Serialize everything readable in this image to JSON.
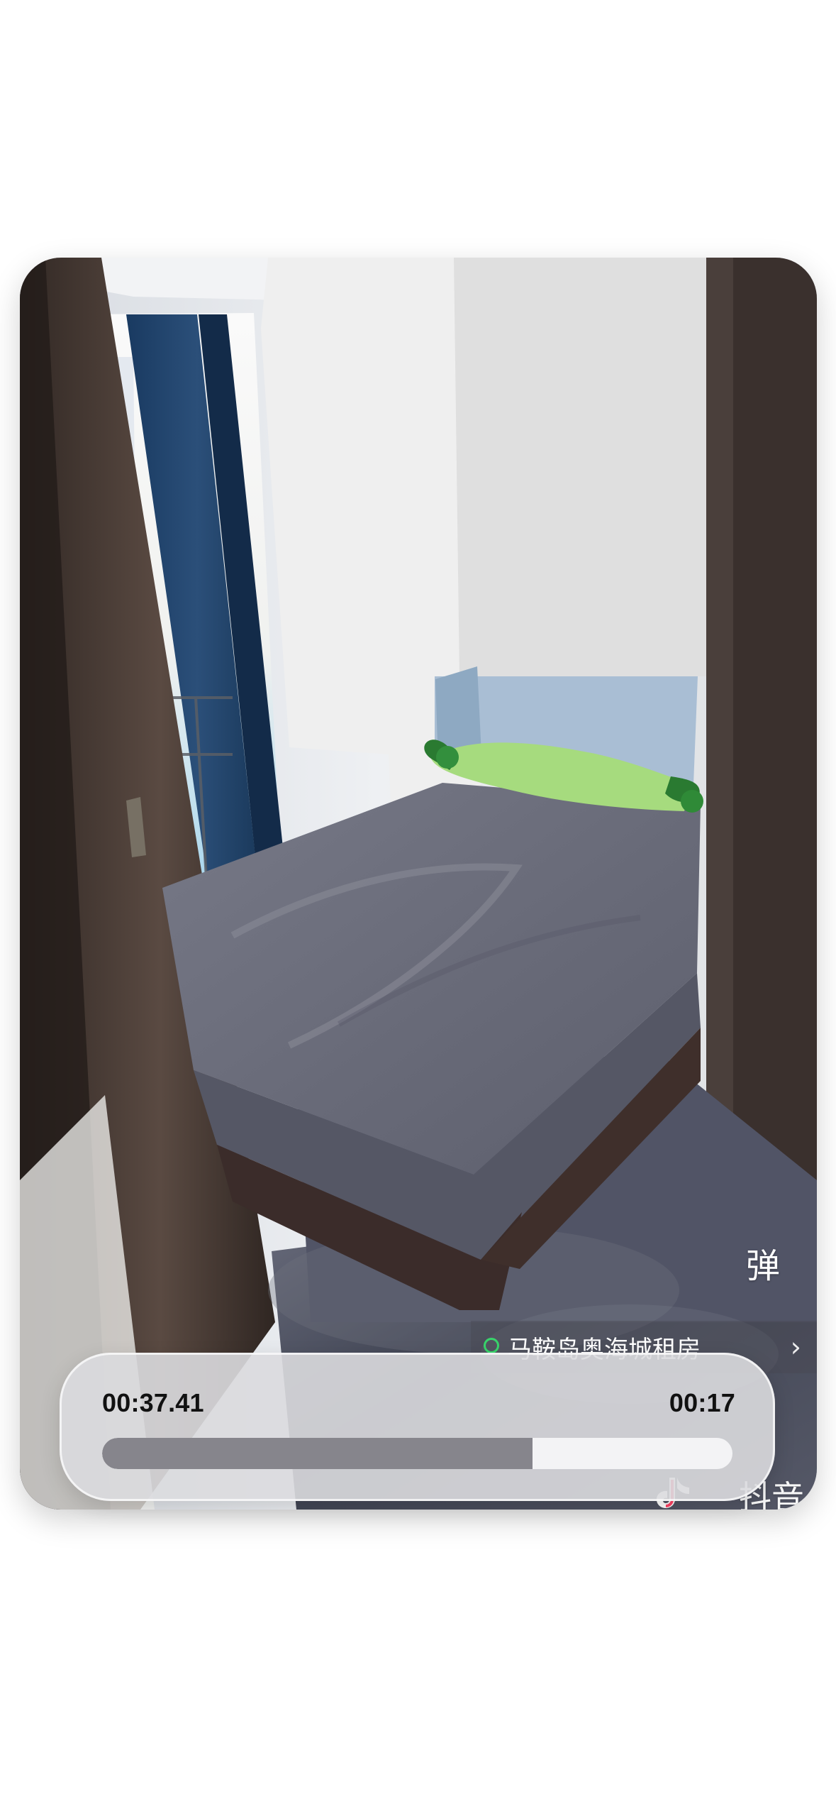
{
  "video": {
    "danmaku_icon": "弹",
    "location_text": "马鞍岛奥海城租房",
    "chevron": "›",
    "watermark": "抖音"
  },
  "scrubber": {
    "current_time": "00:37.41",
    "remaining_time": "00:17",
    "progress": 0.6833
  },
  "colors": {
    "track": "#f3f3f5",
    "fill": "#86858c",
    "panel": "#dadade",
    "location_pin": "#38d46b"
  },
  "icons": {
    "danmaku": "danmaku-toggle-icon",
    "location": "location-pin-icon",
    "chevron": "chevron-right-icon",
    "tiktok": "tiktok-logo-icon"
  }
}
